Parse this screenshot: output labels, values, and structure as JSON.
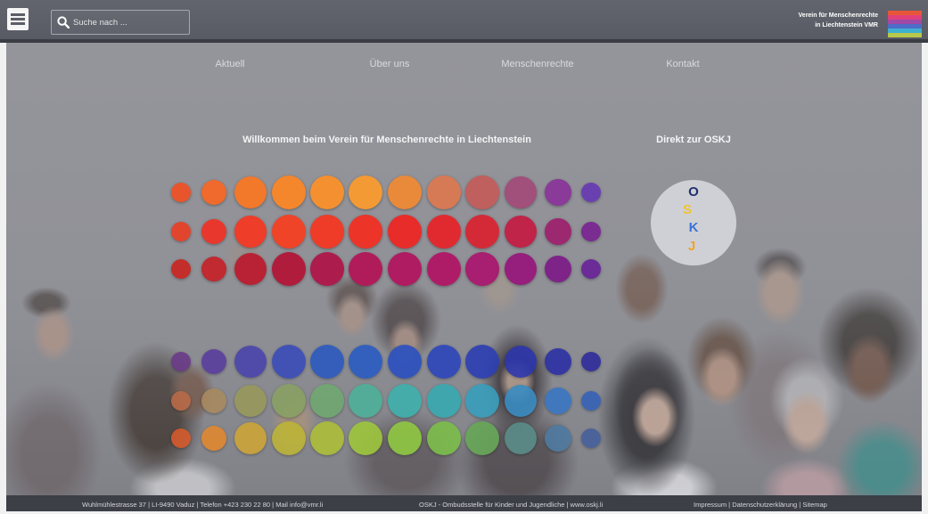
{
  "header": {
    "search_placeholder": "Suche nach ...",
    "org_name_line1": "Verein für Menschenrechte",
    "org_name_line2": "in Liechtenstein VMR",
    "logo_stripes": [
      "#e8563a",
      "#e0407a",
      "#a04aa8",
      "#4f6cc8",
      "#3fb0d0",
      "#b8c84a"
    ]
  },
  "nav": {
    "items": [
      {
        "label": "Aktuell"
      },
      {
        "label": "Über uns"
      },
      {
        "label": "Menschenrechte"
      },
      {
        "label": "Kontakt"
      }
    ]
  },
  "main": {
    "welcome_heading": "Willkommen beim Verein für Menschenrechte in Liechtenstein",
    "oskj_link": "Direkt zur OSKJ"
  },
  "oskj_logo": {
    "background": "#cfd0d5",
    "letters": [
      {
        "char": "O",
        "color": "#1e2f6e"
      },
      {
        "char": "S",
        "color": "#f2c230"
      },
      {
        "char": "K",
        "color": "#3a72d6"
      },
      {
        "char": "J",
        "color": "#f2a32a"
      }
    ]
  },
  "circles": {
    "top": [
      [
        "#e8552d",
        "#ef6a2c",
        "#f2782a",
        "#f4862c",
        "#f59030",
        "#f39a35",
        "#e88a3a",
        "#d67a56",
        "#c0605e",
        "#a0507a",
        "#8a3a98",
        "#6a40b0"
      ],
      [
        "#e2452e",
        "#e8382e",
        "#ee3d28",
        "#f04428",
        "#ee3c28",
        "#ec3428",
        "#e82c2a",
        "#e02a30",
        "#d42a38",
        "#c02448",
        "#9c2870",
        "#7a2c90"
      ],
      [
        "#c42e2a",
        "#c02a30",
        "#b82234",
        "#b01c3c",
        "#ac1c4c",
        "#b01c5a",
        "#b01c62",
        "#ae1c68",
        "#a81e70",
        "#961e7c",
        "#7e2488",
        "#6c2c98"
      ]
    ],
    "bottom": [
      [
        "#6a3a88",
        "#5a3e9e",
        "#4a44ac",
        "#3a4cb8",
        "#2c5ac0",
        "#2a5cc2",
        "#2a50c0",
        "#2c46bc",
        "#2c3eb4",
        "#2c36ac",
        "#2c30a4",
        "#2e2c9a"
      ],
      [
        "#b86a48",
        "#a88a60",
        "#98985c",
        "#88a064",
        "#70a870",
        "#4eb098",
        "#3eb0ac",
        "#38aab2",
        "#389ebc",
        "#3a8cc2",
        "#3a76c2",
        "#3662b6"
      ],
      [
        "#d45a2c",
        "#e08830",
        "#cca438",
        "#bcb438",
        "#acbe38",
        "#9ec63c",
        "#90c842",
        "#7cbe4a",
        "#68a858",
        "#5a8c88",
        "#4f7aa0",
        "#46609c"
      ]
    ]
  },
  "footer": {
    "separator": " | ",
    "left": [
      "Wuhlmühlestrasse 37",
      "LI-9490 Vaduz",
      "Telefon +423 230 22 80",
      "Mail info@vmr.li"
    ],
    "middle": [
      "OSKJ - Ombudsstelle für Kinder und Jugendliche",
      "www.oskj.li"
    ],
    "right": [
      "Impressum",
      "Datenschutzerklärung",
      "Sitemap"
    ]
  }
}
